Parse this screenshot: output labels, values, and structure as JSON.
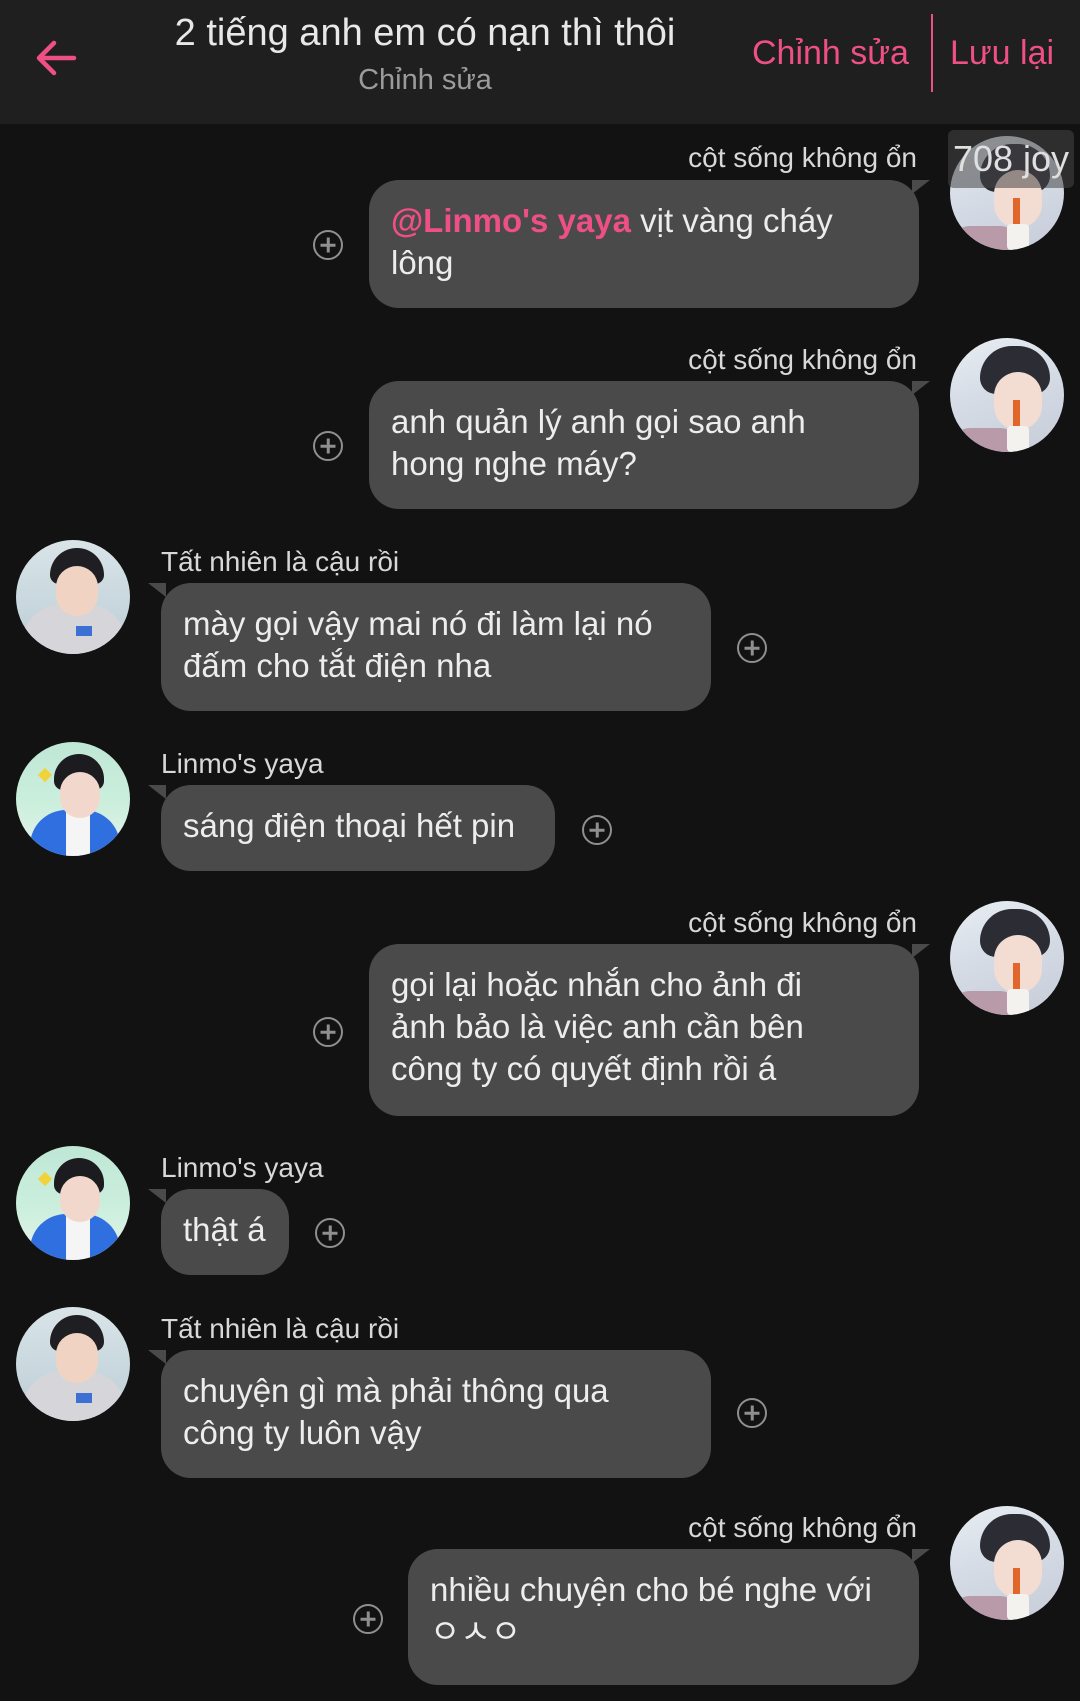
{
  "header": {
    "title": "2 tiếng anh em có nạn thì thôi",
    "subtitle": "Chỉnh sửa",
    "edit_label": "Chỉnh sửa",
    "save_label": "Lưu lại",
    "back_icon": "arrow-left-icon",
    "accent_color": "#ee4f86"
  },
  "overlay": {
    "joy_label": "708 joy"
  },
  "messages": [
    {
      "sender": "cột sống không ổn",
      "side": "right",
      "mention": "@Linmo's yaya",
      "lines": [
        "vịt vàng cháy",
        "lông"
      ]
    },
    {
      "sender": "cột sống không ổn",
      "side": "right",
      "lines": [
        "anh quản lý anh gọi sao anh",
        "hong nghe máy?"
      ]
    },
    {
      "sender": "Tất nhiên là cậu rồi",
      "side": "left",
      "lines": [
        "mày gọi vậy mai nó đi làm lại nó",
        "đấm cho tắt điện nha"
      ]
    },
    {
      "sender": "Linmo's yaya",
      "side": "left",
      "lines": [
        "sáng điện thoại hết pin"
      ]
    },
    {
      "sender": "cột sống không ổn",
      "side": "right",
      "lines": [
        "gọi lại hoặc nhắn cho ảnh đi",
        "ảnh bảo là việc anh cần bên",
        "công ty có quyết định rồi á"
      ]
    },
    {
      "sender": "Linmo's yaya",
      "side": "left",
      "lines": [
        "thật á"
      ]
    },
    {
      "sender": "Tất nhiên là cậu rồi",
      "side": "left",
      "lines": [
        "chuyện gì mà phải thông qua",
        "công ty luôn vậy"
      ]
    },
    {
      "sender": "cột sống không ổn",
      "side": "right",
      "lines": [
        "nhiều chuyện cho bé nghe với",
        "ㅇㅅㅇ"
      ]
    }
  ]
}
